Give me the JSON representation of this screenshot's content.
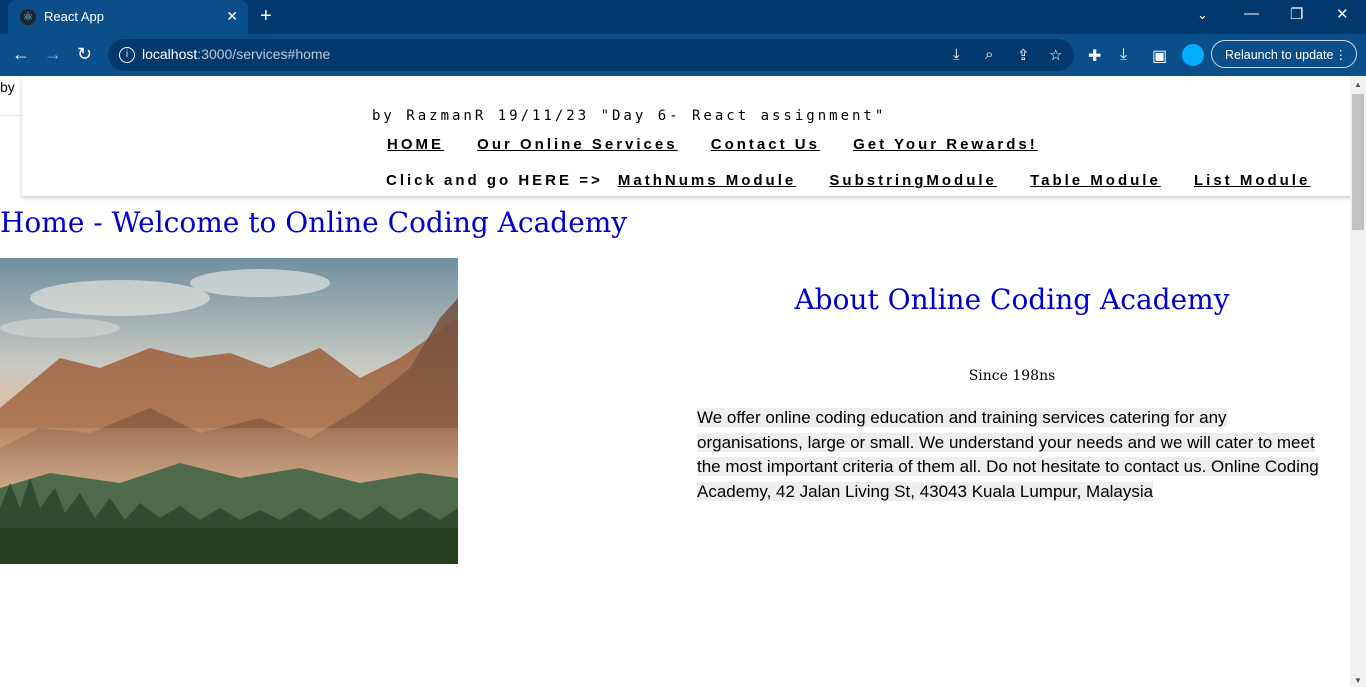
{
  "browser": {
    "tab_title": "React App",
    "new_tab_icon": "plus-icon",
    "url_host": "localhost",
    "url_rest": ":3000/services#home",
    "relaunch_label": "Relaunch to update"
  },
  "page": {
    "stray_text": "by",
    "byline": "by RazmanR 19/11/23 \"Day 6- React assignment\"",
    "nav_main": [
      "HOME",
      "Our Online Services",
      "Contact Us",
      "Get Your Rewards!"
    ],
    "nav_prompt": "Click and go HERE =>",
    "nav_modules": [
      "MathNums Module",
      "SubstringModule",
      "Table Module",
      "List Module"
    ],
    "heading": "Home - Welcome to Online Coding Academy",
    "about_title": "About Online Coding Academy",
    "since": "Since 198ns",
    "description": "We offer online coding education and training services catering for any organisations, large or small. We understand your needs and we will cater to meet the most important criteria of them all. Do not hesitate to contact us.  Online Coding Academy, 42 Jalan Living St, 43043 Kuala Lumpur, Malaysia"
  },
  "colors": {
    "heading": "#0000cd",
    "tabbar": "#03396c",
    "toolbar": "#0b4f8a"
  }
}
